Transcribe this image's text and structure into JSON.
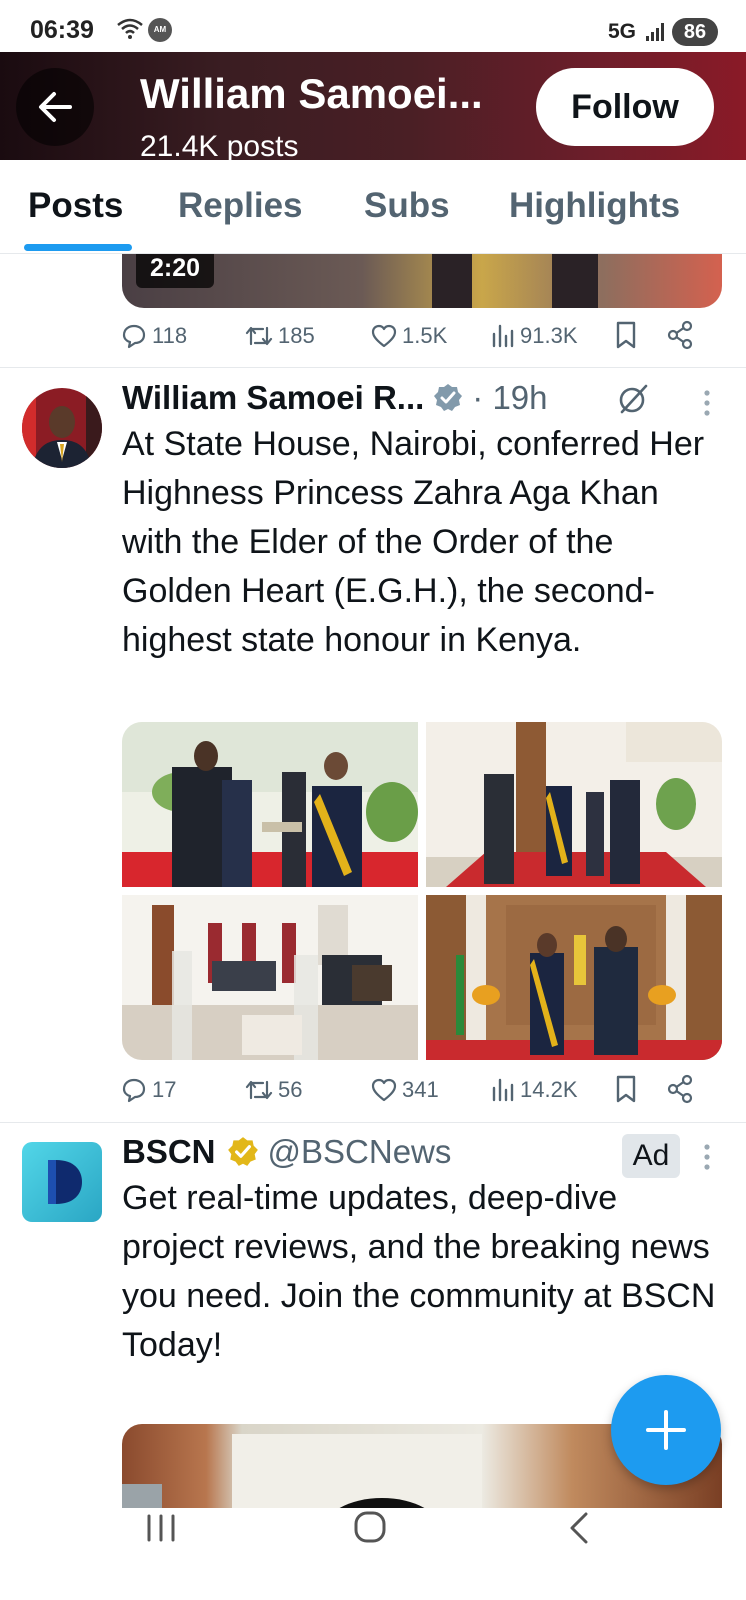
{
  "status_bar": {
    "time": "06:39",
    "network": "5G",
    "battery": "86",
    "wifi_icon": "wifi-icon",
    "amex_icon": "amex-icon",
    "amex_label": "AM EX"
  },
  "header": {
    "title": "William Samoei...",
    "subtitle": "21.4K posts",
    "follow_label": "Follow"
  },
  "tabs": [
    {
      "label": "Posts",
      "active": true
    },
    {
      "label": "Replies",
      "active": false
    },
    {
      "label": "Subs",
      "active": false
    },
    {
      "label": "Highlights",
      "active": false
    }
  ],
  "prev_post": {
    "duration": "2:20",
    "replies": "118",
    "reposts": "185",
    "likes": "1.5K",
    "views": "91.3K"
  },
  "post": {
    "author": "William Samoei R...",
    "time": "· 19h",
    "text": "At State House, Nairobi, conferred Her Highness Princess Zahra Aga Khan with the Elder of the Order of the Golden Heart (E.G.H.), the second-highest state honour in Kenya.",
    "replies": "17",
    "reposts": "56",
    "likes": "341",
    "views": "14.2K"
  },
  "ad": {
    "name": "BSCN",
    "handle": "@BSCNews",
    "badge": "Ad",
    "text": "Get real-time updates, deep-dive project reviews, and the breaking news you need. Join the community at BSCN Today!"
  },
  "colors": {
    "accent": "#1d9bf0",
    "text": "#0f1419",
    "muted": "#536471",
    "verified_blue": "#1d9bf0",
    "verified_gold": "#e2b719"
  }
}
